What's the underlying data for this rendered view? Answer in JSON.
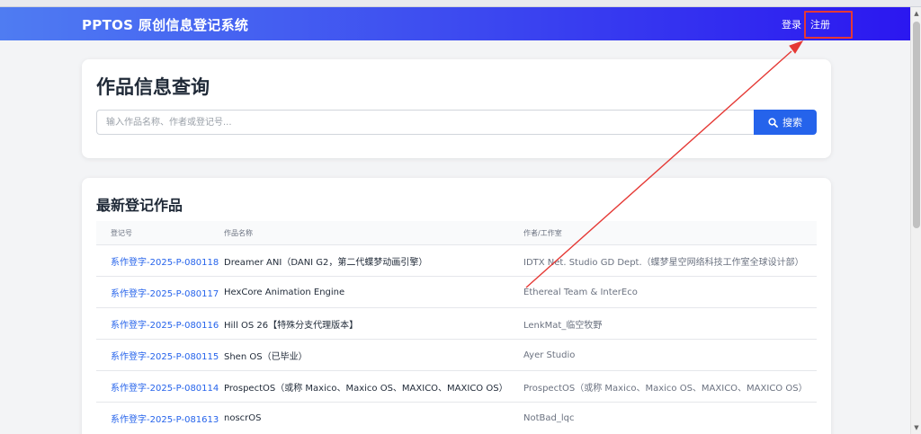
{
  "navbar": {
    "brand": "PPTOS 原创信息登记系统",
    "login_label": "登录",
    "register_label": "注册"
  },
  "search": {
    "title": "作品信息查询",
    "placeholder": "输入作品名称、作者或登记号...",
    "button_label": "搜索",
    "button_icon": "search-icon"
  },
  "latest": {
    "title": "最新登记作品",
    "columns": [
      "登记号",
      "作品名称",
      "作者/工作室"
    ],
    "rows": [
      {
        "id": "系作登字-2025-P-080118",
        "name": "Dreamer ANI（DANI G2，第二代蝶梦动画引擎）",
        "author": "IDTX Net. Studio GD Dept.（蝶梦星空网络科技工作室全球设计部）"
      },
      {
        "id": "系作登字-2025-P-080117",
        "name": "HexCore Animation Engine",
        "author": "Ethereal Team & InterEco"
      },
      {
        "id": "系作登字-2025-P-080116",
        "name": "Hill OS 26【特殊分支代理版本】",
        "author": "LenkMat_临空牧野"
      },
      {
        "id": "系作登字-2025-P-080115",
        "name": "Shen OS（已毕业）",
        "author": "Ayer Studio"
      },
      {
        "id": "系作登字-2025-P-080114",
        "name": "ProspectOS（或称 Maxico、Maxico OS、MAXICO、MAXICO OS）",
        "author": "ProspectOS（或称 Maxico、Maxico OS、MAXICO、MAXICO OS）"
      },
      {
        "id": "系作登字-2025-P-081613",
        "name": "noscrOS",
        "author": "NotBad_lqc"
      }
    ]
  },
  "colors": {
    "nav_gradient_start": "#4f7cf2",
    "nav_gradient_end": "#2b17f0",
    "accent": "#2563eb",
    "annotation_red": "#e53935"
  }
}
